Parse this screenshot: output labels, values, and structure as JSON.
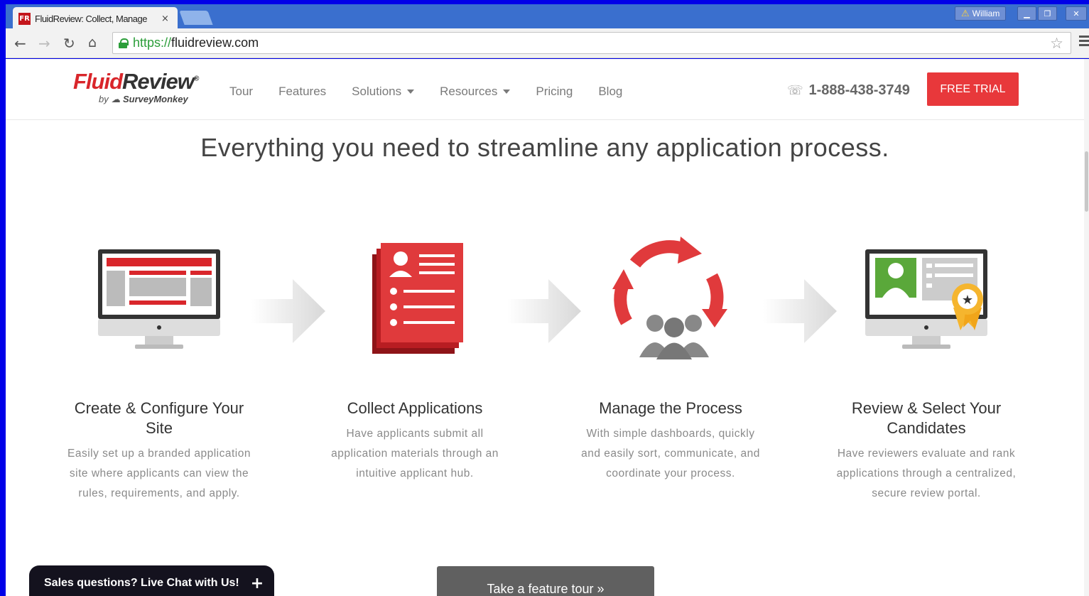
{
  "browser": {
    "tab_title": "FluidReview: Collect, Manage",
    "favicon_text": "FR",
    "tab_close": "×",
    "user_name": "William",
    "url_scheme": "https://",
    "url_host": "fluidreview.com",
    "icons": [
      "back-icon",
      "forward-icon",
      "reload-icon",
      "home-icon",
      "lock-icon",
      "star-icon",
      "menu-icon"
    ]
  },
  "header": {
    "logo_fluid": "Fluid",
    "logo_review": "Review",
    "logo_reg": "®",
    "logo_by": "by",
    "logo_brand": "SurveyMonkey",
    "nav": [
      "Tour",
      "Features",
      "Solutions",
      "Resources",
      "Pricing",
      "Blog"
    ],
    "phone": "1-888-438-3749",
    "cta": "FREE TRIAL"
  },
  "main": {
    "headline": "Everything you need to streamline any application process.",
    "steps": [
      {
        "title": "Create & Configure Your Site",
        "desc": "Easily set up a branded application site where applicants can view the rules, requirements, and apply."
      },
      {
        "title": "Collect Applications",
        "desc": "Have applicants submit all application materials through an intuitive applicant hub."
      },
      {
        "title": "Manage the Process",
        "desc": "With simple dashboards, quickly and easily sort, communicate, and coordinate your process."
      },
      {
        "title": "Review & Select Your Candidates",
        "desc": "Have reviewers evaluate and rank applications through a centralized, secure review portal."
      }
    ],
    "chat_label": "Sales questions? Live Chat with Us!",
    "tour_button": "Take a feature tour »"
  },
  "colors": {
    "brand_red": "#e8383b",
    "chrome_blue": "#3a6fce",
    "dark_gray": "#606060"
  }
}
